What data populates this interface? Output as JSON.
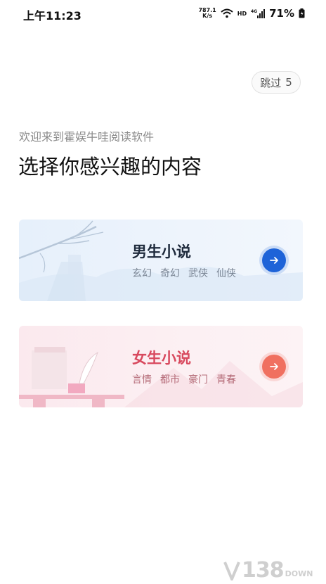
{
  "status_bar": {
    "time": "上午11:23",
    "net_speed_value": "787.1",
    "net_speed_unit": "K/s",
    "hd_label": "HD",
    "battery": "71%",
    "icons": [
      "wifi-icon",
      "signal-4g-icon",
      "battery-icon"
    ]
  },
  "skip": {
    "label": "跳过",
    "countdown": "5"
  },
  "welcome": {
    "subtitle": "欢迎来到霍娱牛哇阅读软件",
    "title": "选择你感兴趣的内容"
  },
  "cards": [
    {
      "title": "男生小说",
      "tags": [
        "玄幻",
        "奇幻",
        "武侠",
        "仙侠"
      ],
      "accent": "#1e63d8"
    },
    {
      "title": "女生小说",
      "tags": [
        "言情",
        "都市",
        "豪门",
        "青春"
      ],
      "accent": "#f07060"
    }
  ],
  "watermark": {
    "number": "138",
    "suffix": "DOWN"
  }
}
